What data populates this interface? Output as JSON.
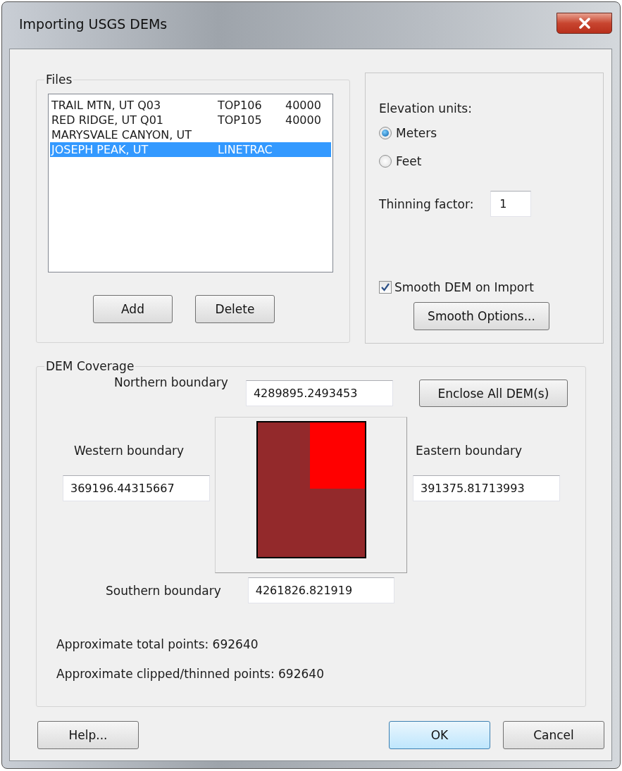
{
  "window": {
    "title": "Importing USGS DEMs"
  },
  "files": {
    "label": "Files",
    "rows": [
      {
        "cells": [
          "TRAIL MTN, UT  Q03",
          "TOP106",
          "40000"
        ],
        "selected": false
      },
      {
        "cells": [
          "RED RIDGE, UT  Q01",
          "TOP105",
          "40000"
        ],
        "selected": false
      },
      {
        "cells": [
          "MARYSVALE CANYON, UT"
        ],
        "selected": false
      },
      {
        "cells": [
          "JOSEPH PEAK, UT",
          "LINETRAC"
        ],
        "selected": true
      }
    ],
    "buttons": [
      "Add",
      "Delete"
    ]
  },
  "options": {
    "units_label": "Elevation units:",
    "units": [
      {
        "label": "Meters",
        "selected": true
      },
      {
        "label": "Feet",
        "selected": false
      }
    ],
    "thinning_label": "Thinning factor:",
    "thinning_value": "1",
    "smooth": {
      "label": "Smooth DEM on Import",
      "checked": true
    },
    "smooth_button": "Smooth Options..."
  },
  "coverage": {
    "label": "DEM Coverage",
    "northern": {
      "label": "Northern boundary",
      "value": "4289895.2493453"
    },
    "enclose_button": "Enclose All DEM(s)",
    "western": {
      "label": "Western boundary",
      "value": "369196.44315667"
    },
    "eastern": {
      "label": "Eastern boundary",
      "value": "391375.81713993"
    },
    "southern": {
      "label": "Southern boundary",
      "value": "4261826.821919"
    },
    "total_points": "Approximate total points: 692640",
    "clipped_points": "Approximate clipped/thinned points: 692640"
  },
  "buttons": [
    {
      "label": "Help...",
      "kind": "normal"
    },
    {
      "label": "OK",
      "kind": "default"
    },
    {
      "label": "Cancel",
      "kind": "normal"
    }
  ]
}
